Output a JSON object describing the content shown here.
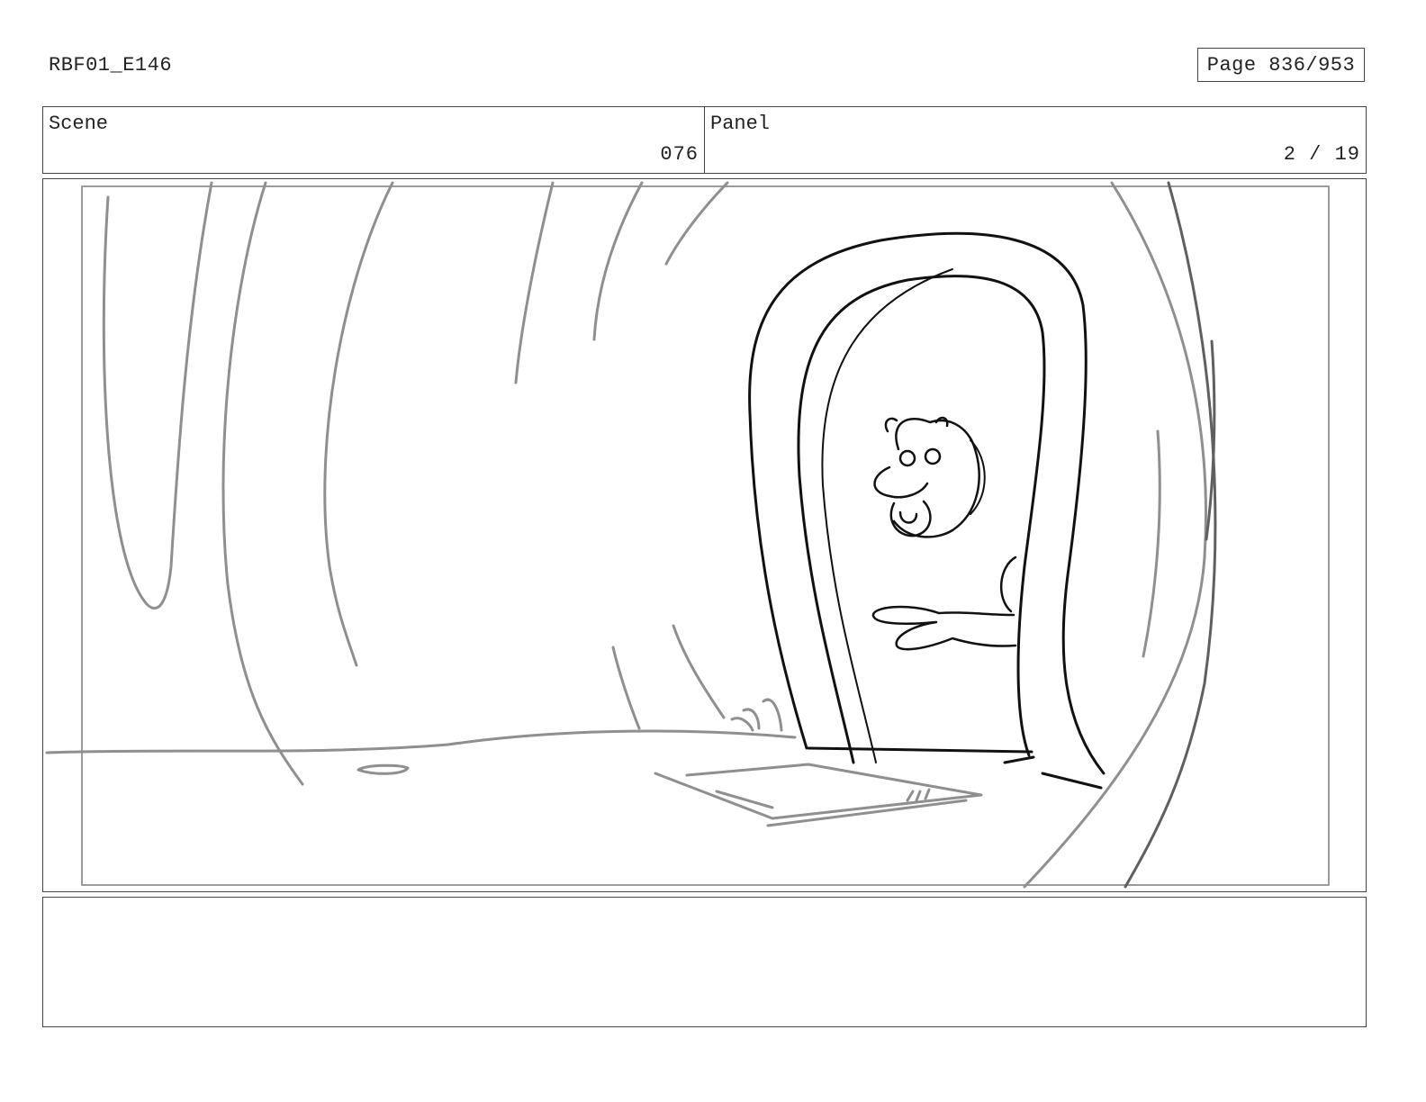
{
  "header": {
    "doc_code": "RBF01_E146",
    "page_label": "Page 836/953"
  },
  "fields": {
    "scene_label": "Scene",
    "scene_value": "076",
    "panel_label": "Panel",
    "panel_value": "2 / 19"
  },
  "drawing": {
    "ink_color": "#111111",
    "sketch_color": "#8f8f8f",
    "frame_color": "#9a9a9a"
  },
  "notes": {
    "text": ""
  }
}
